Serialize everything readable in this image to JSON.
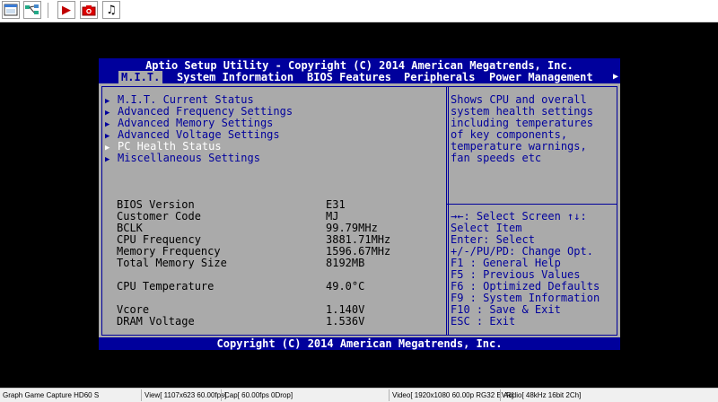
{
  "toolbar": {
    "buttons": [
      {
        "icon": "window-icon"
      },
      {
        "icon": "graph-icon"
      },
      {
        "icon": "play-icon",
        "glyph": "▶"
      },
      {
        "icon": "camera-icon"
      },
      {
        "icon": "music-icon",
        "glyph": "♫"
      }
    ]
  },
  "bios": {
    "title": "Aptio Setup Utility - Copyright (C) 2014 American Megatrends, Inc.",
    "tabs": [
      "M.I.T.",
      "System Information",
      "BIOS Features",
      "Peripherals",
      "Power Management"
    ],
    "tab_more": "▶",
    "menu": [
      {
        "label": "M.I.T. Current Status",
        "selected": false
      },
      {
        "label": "Advanced Frequency Settings",
        "selected": false
      },
      {
        "label": "Advanced Memory Settings",
        "selected": false
      },
      {
        "label": "Advanced Voltage Settings",
        "selected": false
      },
      {
        "label": "PC Health Status",
        "selected": true
      },
      {
        "label": "Miscellaneous Settings",
        "selected": false
      }
    ],
    "menu_arrow": "▶",
    "info": [
      {
        "label": "BIOS Version",
        "value": "E31"
      },
      {
        "label": "Customer Code",
        "value": "MJ"
      },
      {
        "label": "BCLK",
        "value": "99.79MHz"
      },
      {
        "label": "CPU Frequency",
        "value": "3881.71MHz"
      },
      {
        "label": "Memory Frequency",
        "value": "1596.67MHz"
      },
      {
        "label": "Total Memory Size",
        "value": "8192MB"
      },
      {
        "label": "CPU Temperature",
        "value": "49.0°C"
      },
      {
        "label": "Vcore",
        "value": "1.140V"
      },
      {
        "label": "DRAM Voltage",
        "value": "1.536V"
      }
    ],
    "help": [
      "Shows CPU and overall",
      "system health settings",
      "including temperatures",
      "of key components,",
      "temperature warnings,",
      "fan speeds etc"
    ],
    "keys": [
      "→←: Select Screen  ↑↓:",
      "Select Item",
      "Enter: Select",
      "+/-/PU/PD: Change Opt.",
      "F1  : General Help",
      "F5  : Previous Values",
      "F6  : Optimized Defaults",
      "F9  : System Information",
      "F10 : Save & Exit",
      "ESC : Exit"
    ],
    "footer": "Copyright (C) 2014 American Megatrends, Inc."
  },
  "statusbar": {
    "device": "Graph Game Capture HD60 S",
    "view": "View[ 1107x623 60.00fps]",
    "cap": "Cap[ 60.00fps 0Drop]",
    "video": "Video[ 1920x1080 60.00p RG32 EVR]",
    "audio": "Audio[ 48kHz 16bit 2Ch]"
  }
}
